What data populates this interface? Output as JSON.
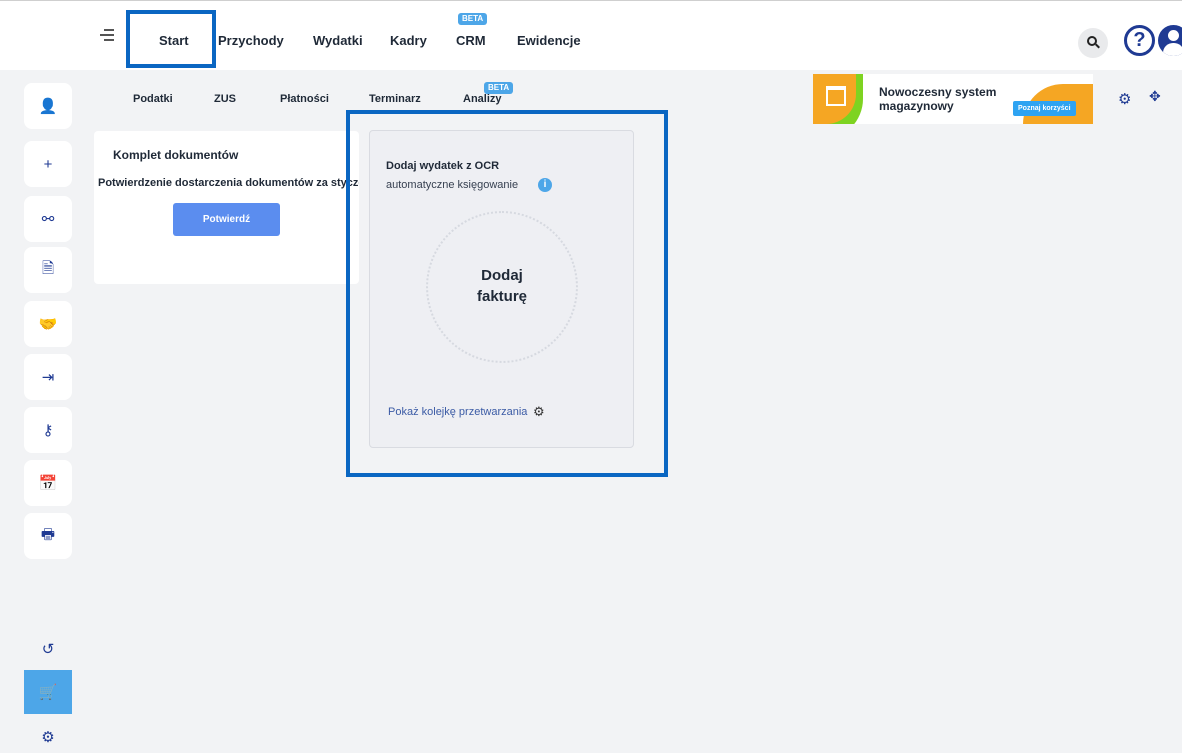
{
  "topnav": {
    "items": [
      {
        "label": "Start"
      },
      {
        "label": "Przychody"
      },
      {
        "label": "Wydatki"
      },
      {
        "label": "Kadry"
      },
      {
        "label": "CRM",
        "badge": "BETA"
      },
      {
        "label": "Ewidencje"
      }
    ],
    "search_icon": "search-icon",
    "help_icon": "help-icon",
    "help_glyph": "?",
    "avatar_icon": "user-avatar-icon"
  },
  "subnav": {
    "items": [
      {
        "label": "Podatki"
      },
      {
        "label": "ZUS"
      },
      {
        "label": "Płatności"
      },
      {
        "label": "Terminarz"
      },
      {
        "label": "Analizy",
        "badge": "BETA"
      }
    ]
  },
  "sidebar": {
    "items": [
      {
        "icon": "user-edit-icon",
        "glyph": "👤"
      },
      {
        "icon": "plus-icon",
        "glyph": "+"
      },
      {
        "icon": "sliders-icon",
        "glyph": "⚯"
      },
      {
        "icon": "document-icon",
        "glyph": "🗎"
      },
      {
        "icon": "handshake-icon",
        "glyph": "🤝"
      },
      {
        "icon": "import-icon",
        "glyph": "⇥"
      },
      {
        "icon": "person-key-icon",
        "glyph": "⚷"
      },
      {
        "icon": "calendar-add-icon",
        "glyph": "📅"
      },
      {
        "icon": "print-icon",
        "glyph": "🖶"
      }
    ],
    "bottom_items": [
      {
        "icon": "history-icon",
        "glyph": "↺"
      },
      {
        "icon": "cart-icon",
        "glyph": "🛒",
        "active": true
      },
      {
        "icon": "settings-icon",
        "glyph": "⚙"
      }
    ]
  },
  "ad_banner": {
    "title": "Nowoczesny system magazynowy",
    "cta": "Poznaj korzyści",
    "colors": {
      "green": "#7ed321",
      "orange": "#f5a623",
      "cta": "#2ea3f2"
    }
  },
  "toolbar_right": {
    "settings_icon": "settings-icon",
    "settings_glyph": "⚙",
    "move_icon": "move-icon",
    "move_glyph": "✥"
  },
  "card_documents": {
    "title": "Komplet dokumentów",
    "description": "Potwierdzenie dostarczenia dokumentów za styczeń",
    "button_label": "Potwierdź"
  },
  "card_ocr": {
    "title": "Dodaj wydatek z OCR",
    "subtitle": "automatyczne księgowanie",
    "info_glyph": "i",
    "drop_label_line1": "Dodaj",
    "drop_label_line2": "fakturę",
    "queue_link": "Pokaż kolejkę przetwarzania",
    "queue_gear_glyph": "⚙"
  },
  "colors": {
    "primary": "#1f3a93",
    "accent": "#4da6e8",
    "button": "#5b8def",
    "highlight_border": "#0a66c2"
  }
}
